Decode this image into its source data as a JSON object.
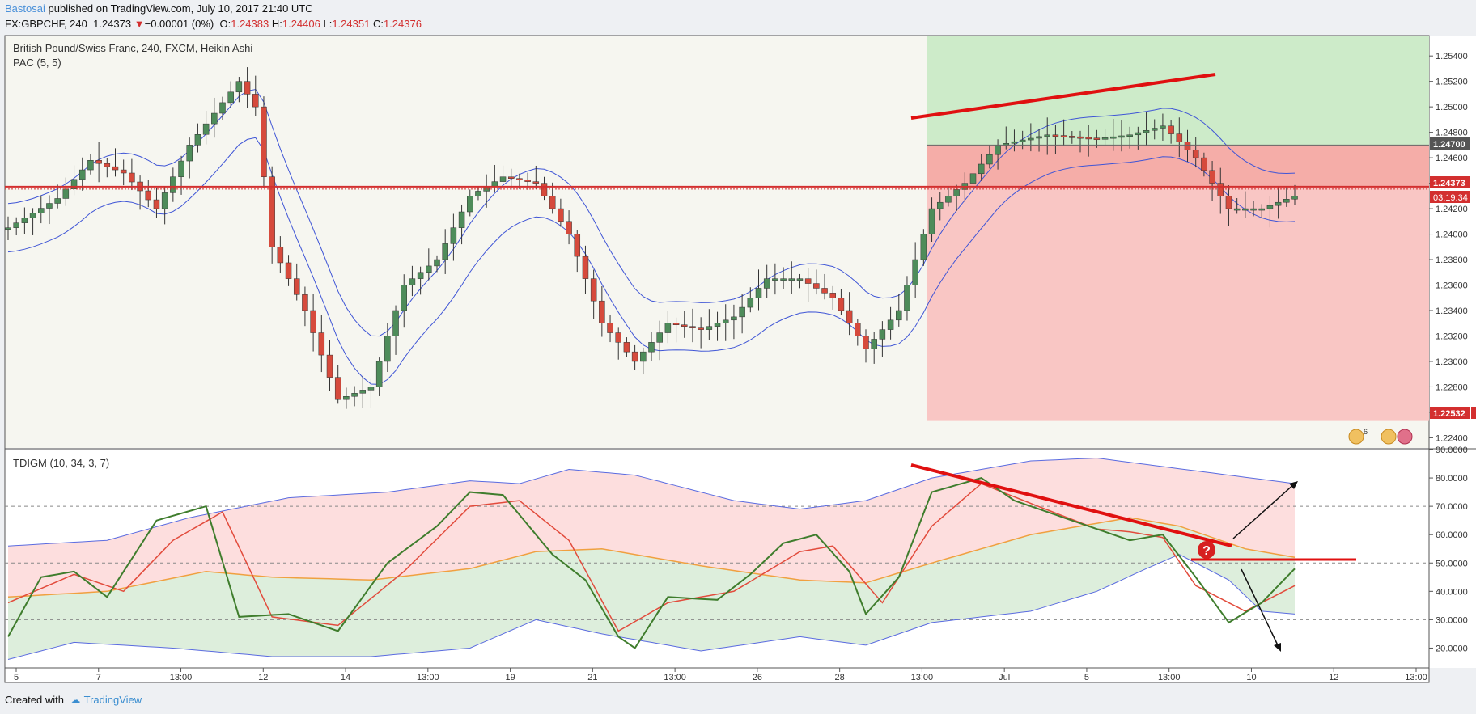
{
  "header": {
    "author": "Bastosai",
    "published": "published on TradingView.com, July 10, 2017 21:40 UTC",
    "symbol": "FX:GBPCHF, 240",
    "last": "1.24373",
    "change_arrow": "▼",
    "change": "−0.00001 (0%)",
    "o_label": "O:",
    "o_val": "1.24383",
    "h_label": "H:",
    "h_val": "1.24406",
    "l_label": "L:",
    "l_val": "1.24351",
    "c_label": "C:",
    "c_val": "1.24376"
  },
  "price_pane": {
    "title": "British Pound/Swiss Franc, 240, FXCM, Heikin Ashi",
    "indicator": "PAC (5, 5)",
    "y_ticks": [
      "1.25400",
      "1.25200",
      "1.25000",
      "1.24800",
      "1.24600",
      "1.24400",
      "1.24200",
      "1.24000",
      "1.23800",
      "1.23600",
      "1.23400",
      "1.23200",
      "1.23000",
      "1.22800",
      "1.22600",
      "1.22400"
    ],
    "badges": {
      "target": "1.24700",
      "current": "1.24373",
      "countdown": "03:19:34",
      "stop": "1.22532"
    },
    "event_count": "6"
  },
  "oscillator_pane": {
    "title": "TDIGM (10, 34, 3, 7)",
    "y_ticks": [
      "90.0000",
      "80.0000",
      "70.0000",
      "60.0000",
      "50.0000",
      "40.0000",
      "30.0000",
      "20.0000"
    ],
    "question_mark": "?"
  },
  "x_axis": {
    "ticks": [
      "5",
      "7",
      "13:00",
      "12",
      "14",
      "13:00",
      "19",
      "21",
      "13:00",
      "26",
      "28",
      "13:00",
      "Jul",
      "5",
      "13:00",
      "10",
      "12",
      "13:00"
    ]
  },
  "footer": {
    "created_with": "Created with",
    "brand": "TradingView"
  },
  "colors": {
    "bull": "#4e8c5a",
    "bear": "#d64a3c",
    "pac": "#3f55d6",
    "tdi_green": "#3f7d2d",
    "tdi_red": "#e24b3c",
    "tdi_orange": "#f0a040",
    "band_blue": "#5a6be0",
    "drawing_red": "#e01010"
  },
  "chart_data": [
    {
      "type": "candlestick",
      "title": "British Pound/Swiss Franc, 240, FXCM, Heikin Ashi",
      "ylim": [
        1.2232,
        1.2556
      ],
      "x_ticks": [
        "5",
        "7",
        "13:00",
        "12",
        "14",
        "13:00",
        "19",
        "21",
        "13:00",
        "26",
        "28",
        "13:00",
        "Jul",
        "5",
        "13:00",
        "10",
        "12",
        "13:00"
      ],
      "anchors": [
        [
          0,
          1.2405
        ],
        [
          6,
          1.2428
        ],
        [
          10,
          1.2458
        ],
        [
          14,
          1.2448
        ],
        [
          18,
          1.242
        ],
        [
          22,
          1.247
        ],
        [
          28,
          1.252
        ],
        [
          30,
          1.25
        ],
        [
          32,
          1.239
        ],
        [
          36,
          1.234
        ],
        [
          40,
          1.227
        ],
        [
          44,
          1.228
        ],
        [
          48,
          1.236
        ],
        [
          52,
          1.238
        ],
        [
          56,
          1.243
        ],
        [
          60,
          1.2445
        ],
        [
          64,
          1.244
        ],
        [
          68,
          1.24
        ],
        [
          72,
          1.233
        ],
        [
          76,
          1.23
        ],
        [
          80,
          1.233
        ],
        [
          84,
          1.2325
        ],
        [
          88,
          1.2335
        ],
        [
          92,
          1.2365
        ],
        [
          96,
          1.2365
        ],
        [
          100,
          1.235
        ],
        [
          104,
          1.231
        ],
        [
          108,
          1.234
        ],
        [
          112,
          1.242
        ],
        [
          116,
          1.244
        ],
        [
          120,
          1.247
        ],
        [
          126,
          1.2478
        ],
        [
          132,
          1.2475
        ],
        [
          136,
          1.2478
        ],
        [
          140,
          1.2485
        ],
        [
          144,
          1.246
        ],
        [
          148,
          1.242
        ],
        [
          152,
          1.242
        ],
        [
          156,
          1.243
        ]
      ],
      "pac_band_offset": 0.0038,
      "horizontal_levels": {
        "current": 1.24373,
        "target": 1.247,
        "stop": 1.22532
      },
      "trendline": {
        "from": [
          1.249,
          "start"
        ],
        "to": [
          1.2524,
          "end"
        ]
      }
    },
    {
      "type": "line",
      "title": "TDIGM (10, 34, 3, 7)",
      "ylim": [
        13,
        90
      ],
      "levels": [
        70,
        50,
        30
      ],
      "series": [
        {
          "anchors": [
            [
              0,
              24
            ],
            [
              4,
              45
            ],
            [
              8,
              47
            ],
            [
              12,
              38
            ],
            [
              18,
              65
            ],
            [
              24,
              70
            ],
            [
              28,
              31
            ],
            [
              34,
              32
            ],
            [
              40,
              26
            ],
            [
              46,
              50
            ],
            [
              52,
              63
            ],
            [
              56,
              75
            ],
            [
              60,
              74
            ],
            [
              66,
              53
            ],
            [
              70,
              44
            ],
            [
              74,
              24
            ],
            [
              76,
              20
            ],
            [
              80,
              38
            ],
            [
              86,
              37
            ],
            [
              90,
              46
            ],
            [
              94,
              57
            ],
            [
              98,
              60
            ],
            [
              102,
              47
            ],
            [
              104,
              32
            ],
            [
              108,
              45
            ],
            [
              112,
              75
            ],
            [
              118,
              80
            ],
            [
              122,
              72
            ],
            [
              130,
              64
            ],
            [
              136,
              58
            ],
            [
              140,
              60
            ],
            [
              144,
              45
            ],
            [
              148,
              29
            ],
            [
              152,
              36
            ],
            [
              156,
              48
            ]
          ]
        },
        {
          "anchors": [
            [
              0,
              36
            ],
            [
              8,
              46
            ],
            [
              14,
              40
            ],
            [
              20,
              58
            ],
            [
              26,
              68
            ],
            [
              32,
              31
            ],
            [
              40,
              28
            ],
            [
              48,
              47
            ],
            [
              56,
              70
            ],
            [
              62,
              72
            ],
            [
              68,
              58
            ],
            [
              74,
              26
            ],
            [
              80,
              36
            ],
            [
              88,
              40
            ],
            [
              96,
              54
            ],
            [
              100,
              56
            ],
            [
              106,
              36
            ],
            [
              112,
              63
            ],
            [
              118,
              78
            ],
            [
              124,
              71
            ],
            [
              132,
              62
            ],
            [
              136,
              61
            ],
            [
              140,
              59
            ],
            [
              144,
              42
            ],
            [
              150,
              33
            ],
            [
              156,
              42
            ]
          ]
        },
        {
          "anchors": [
            [
              0,
              38
            ],
            [
              12,
              40
            ],
            [
              24,
              47
            ],
            [
              32,
              45
            ],
            [
              44,
              44
            ],
            [
              56,
              48
            ],
            [
              64,
              54
            ],
            [
              72,
              55
            ],
            [
              84,
              49
            ],
            [
              96,
              44
            ],
            [
              104,
              43
            ],
            [
              112,
              50
            ],
            [
              124,
              60
            ],
            [
              136,
              66
            ],
            [
              142,
              63
            ],
            [
              150,
              55
            ],
            [
              156,
              52
            ]
          ]
        },
        {
          "anchors": [
            [
              0,
              56
            ],
            [
              12,
              58
            ],
            [
              22,
              66
            ],
            [
              34,
              73
            ],
            [
              46,
              75
            ],
            [
              56,
              79
            ],
            [
              62,
              78
            ],
            [
              68,
              83
            ],
            [
              76,
              81
            ],
            [
              88,
              72
            ],
            [
              96,
              69
            ],
            [
              104,
              72
            ],
            [
              112,
              80
            ],
            [
              124,
              86
            ],
            [
              132,
              87
            ],
            [
              140,
              84
            ],
            [
              148,
              81
            ],
            [
              156,
              78
            ]
          ]
        },
        {
          "anchors": [
            [
              0,
              16
            ],
            [
              8,
              22
            ],
            [
              20,
              20
            ],
            [
              32,
              17
            ],
            [
              44,
              17
            ],
            [
              56,
              20
            ],
            [
              64,
              30
            ],
            [
              72,
              25
            ],
            [
              84,
              19
            ],
            [
              96,
              24
            ],
            [
              104,
              21
            ],
            [
              112,
              29
            ],
            [
              124,
              33
            ],
            [
              132,
              40
            ],
            [
              138,
              48
            ],
            [
              142,
              53
            ],
            [
              148,
              44
            ],
            [
              152,
              33
            ],
            [
              156,
              32
            ]
          ]
        }
      ]
    }
  ]
}
